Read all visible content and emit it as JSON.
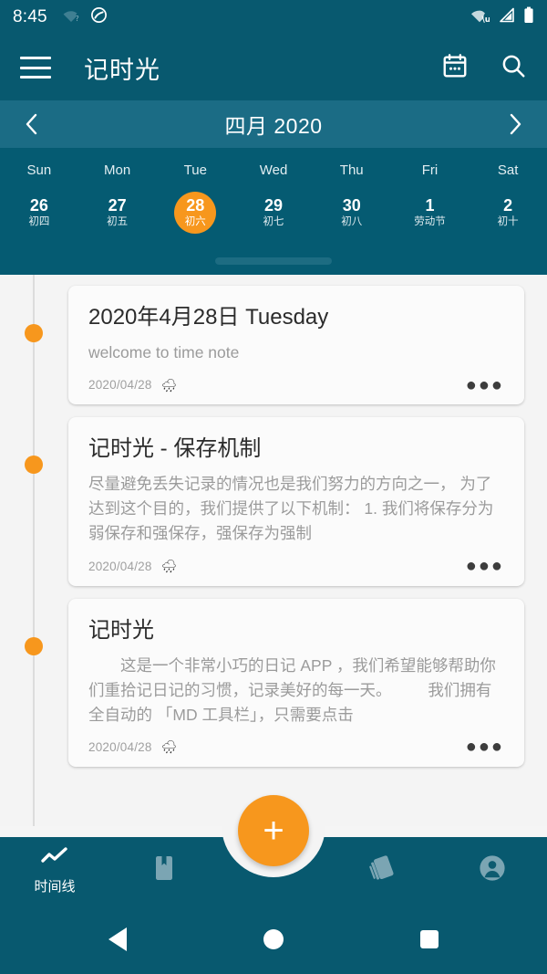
{
  "statusbar": {
    "time": "8:45",
    "left_icons": [
      "wifi-question-icon",
      "dnd-icon"
    ],
    "right_icons": [
      "wifi-off-icon",
      "cellular-signal-icon",
      "battery-full-icon"
    ]
  },
  "appbar": {
    "menu_icon": "hamburger-menu-icon",
    "title": "记时光",
    "calendar_icon": "calendar-icon",
    "search_icon": "search-icon"
  },
  "calendar": {
    "prev_label": "‹",
    "next_label": "›",
    "month_label": "四月 2020",
    "weekdays": [
      "Sun",
      "Mon",
      "Tue",
      "Wed",
      "Thu",
      "Fri",
      "Sat"
    ],
    "days": [
      {
        "num": "26",
        "lunar": "初四",
        "selected": false
      },
      {
        "num": "27",
        "lunar": "初五",
        "selected": false
      },
      {
        "num": "28",
        "lunar": "初六",
        "selected": true
      },
      {
        "num": "29",
        "lunar": "初七",
        "selected": false
      },
      {
        "num": "30",
        "lunar": "初八",
        "selected": false
      },
      {
        "num": "1",
        "lunar": "劳动节",
        "selected": false
      },
      {
        "num": "2",
        "lunar": "初十",
        "selected": false
      }
    ]
  },
  "timeline": {
    "entries": [
      {
        "title": "2020年4月28日 Tuesday",
        "body": "welcome to time note",
        "date": "2020/04/28",
        "weather_icon": "rain-cloud-icon",
        "weather_glyph": "🌧",
        "more_label": "●●●"
      },
      {
        "title": "记时光 - 保存机制",
        "body": "尽量避免丢失记录的情况也是我们努力的方向之一，\n为了达到这个目的，我们提供了以下机制：\n1. 我们将保存分为弱保存和强保存，强保存为强制",
        "date": "2020/04/28",
        "weather_icon": "rain-cloud-icon",
        "weather_glyph": "🌧",
        "more_label": "●●●"
      },
      {
        "title": "记时光",
        "body": "　　这是一个非常小巧的日记 APP ，我们希望能够帮助你们重拾记日记的习惯，记录美好的每一天。\n　　我们拥有全自动的 「MD 工具栏」，只需要点击",
        "date": "2020/04/28",
        "weather_icon": "rain-cloud-icon",
        "weather_glyph": "🌧",
        "more_label": "●●●"
      }
    ]
  },
  "bottom_nav": {
    "items": [
      {
        "icon": "timeline-icon",
        "label": "时间线",
        "active": true
      },
      {
        "icon": "bookmark-icon",
        "label": "",
        "active": false
      },
      {
        "icon": "",
        "label": "",
        "active": false
      },
      {
        "icon": "cards-stack-icon",
        "label": "",
        "active": false
      },
      {
        "icon": "account-circle-icon",
        "label": "",
        "active": false
      }
    ],
    "fab": {
      "icon": "add-icon",
      "label": "+"
    }
  },
  "android_nav": {
    "back": "back-triangle-icon",
    "home": "home-circle-icon",
    "recents": "recents-square-icon"
  },
  "colors": {
    "primary": "#08596f",
    "primary_light": "#1b6c85",
    "calendar_bg": "#055b72",
    "accent": "#f7971d",
    "card_bg": "#fbfbfb",
    "page_bg": "#f4f4f4"
  }
}
